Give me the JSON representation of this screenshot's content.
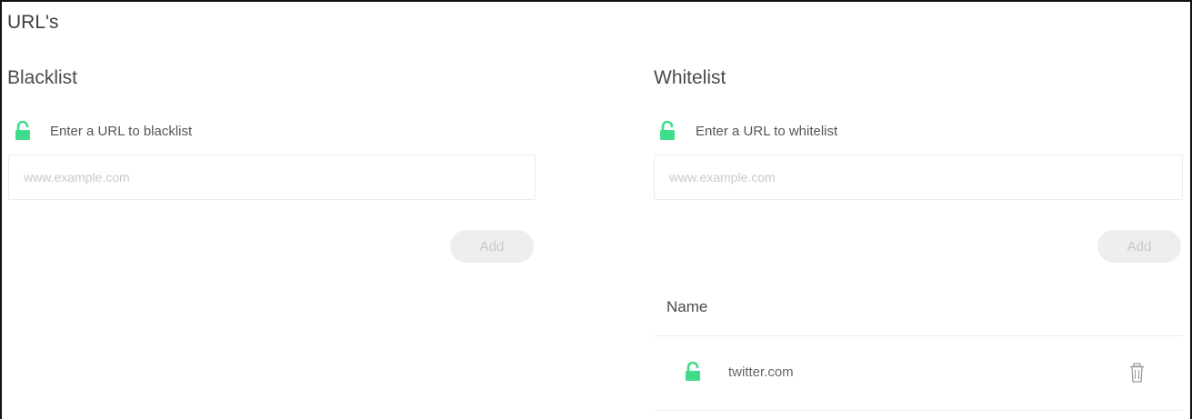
{
  "page": {
    "title": "URL's"
  },
  "blacklist": {
    "title": "Blacklist",
    "hint": "Enter a URL to blacklist",
    "placeholder": "www.example.com",
    "add_label": "Add"
  },
  "whitelist": {
    "title": "Whitelist",
    "hint": "Enter a URL to whitelist",
    "placeholder": "www.example.com",
    "add_label": "Add",
    "table": {
      "header": "Name",
      "rows": [
        {
          "name": "twitter.com"
        }
      ]
    }
  },
  "icons": {
    "lock": "unlock-icon",
    "delete": "trash-icon"
  },
  "colors": {
    "accent": "#3fdc8a",
    "button_bg": "#eeeeee",
    "button_text": "#c8c8c8"
  }
}
